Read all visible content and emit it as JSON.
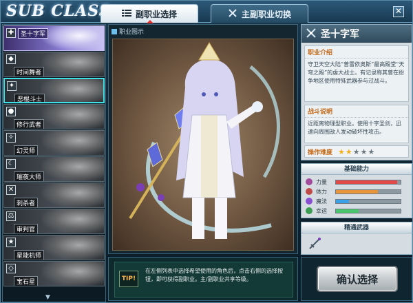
{
  "window": {
    "app_title": "SUB CLASS",
    "close_label": "✕"
  },
  "tabs": [
    {
      "label": "副职业选择",
      "active": true
    },
    {
      "label": "主副职业切换",
      "active": false
    }
  ],
  "class_list": {
    "items": [
      {
        "label": "圣十字军",
        "selected": true
      },
      {
        "label": "时间舞者"
      },
      {
        "label": "恶棍斗士",
        "hovered": true
      },
      {
        "label": "修行武者"
      },
      {
        "label": "幻灵师"
      },
      {
        "label": "璀夜大师"
      },
      {
        "label": "刺杀者"
      },
      {
        "label": "审判官"
      },
      {
        "label": "星能机师"
      },
      {
        "label": "宝石星"
      }
    ]
  },
  "preview": {
    "label": "职业图示"
  },
  "info": {
    "class_name": "圣十字军",
    "intro_title": "职业介绍",
    "intro_text": "守卫天空大陆“普雷依奥斯”最高殿堂“天穹之殿”的虔大战士。有记录称其曾在纷争地区使用特殊武器参与过战斗。",
    "combat_title": "战斗说明",
    "combat_text": "近距离物理型职业。使用十字圣剑，迅速向周围敌人发动破坏性攻击。",
    "difficulty_label": "操作难度",
    "difficulty": 2,
    "difficulty_max": 5
  },
  "stats": {
    "title": "基础能力",
    "items": [
      {
        "label": "力量",
        "value": 0.95,
        "color": "#e24a4a",
        "icon": "sword-icon"
      },
      {
        "label": "体力",
        "value": 0.65,
        "color": "#e8953a",
        "icon": "heart-icon"
      },
      {
        "label": "魔法",
        "value": 0.2,
        "color": "#3aa0e8",
        "icon": "magic-icon"
      },
      {
        "label": "幸运",
        "value": 0.35,
        "color": "#48c46a",
        "icon": "clover-icon"
      }
    ]
  },
  "weapon": {
    "title": "精通武器",
    "icon": "sword-weapon-icon"
  },
  "tip": {
    "tag": "TIP!",
    "text": "在左侧列表中选择希望使用的角色后，点击右侧的选择按钮，即可获得副职业。主/副职业共享等级。"
  },
  "confirm_label": "确认选择",
  "colors": {
    "accent": "#5b8aa6",
    "selected_item": "#8a7fd6",
    "hover_outline": "#3fe0e6",
    "difficulty_star": "#f3b01b"
  }
}
